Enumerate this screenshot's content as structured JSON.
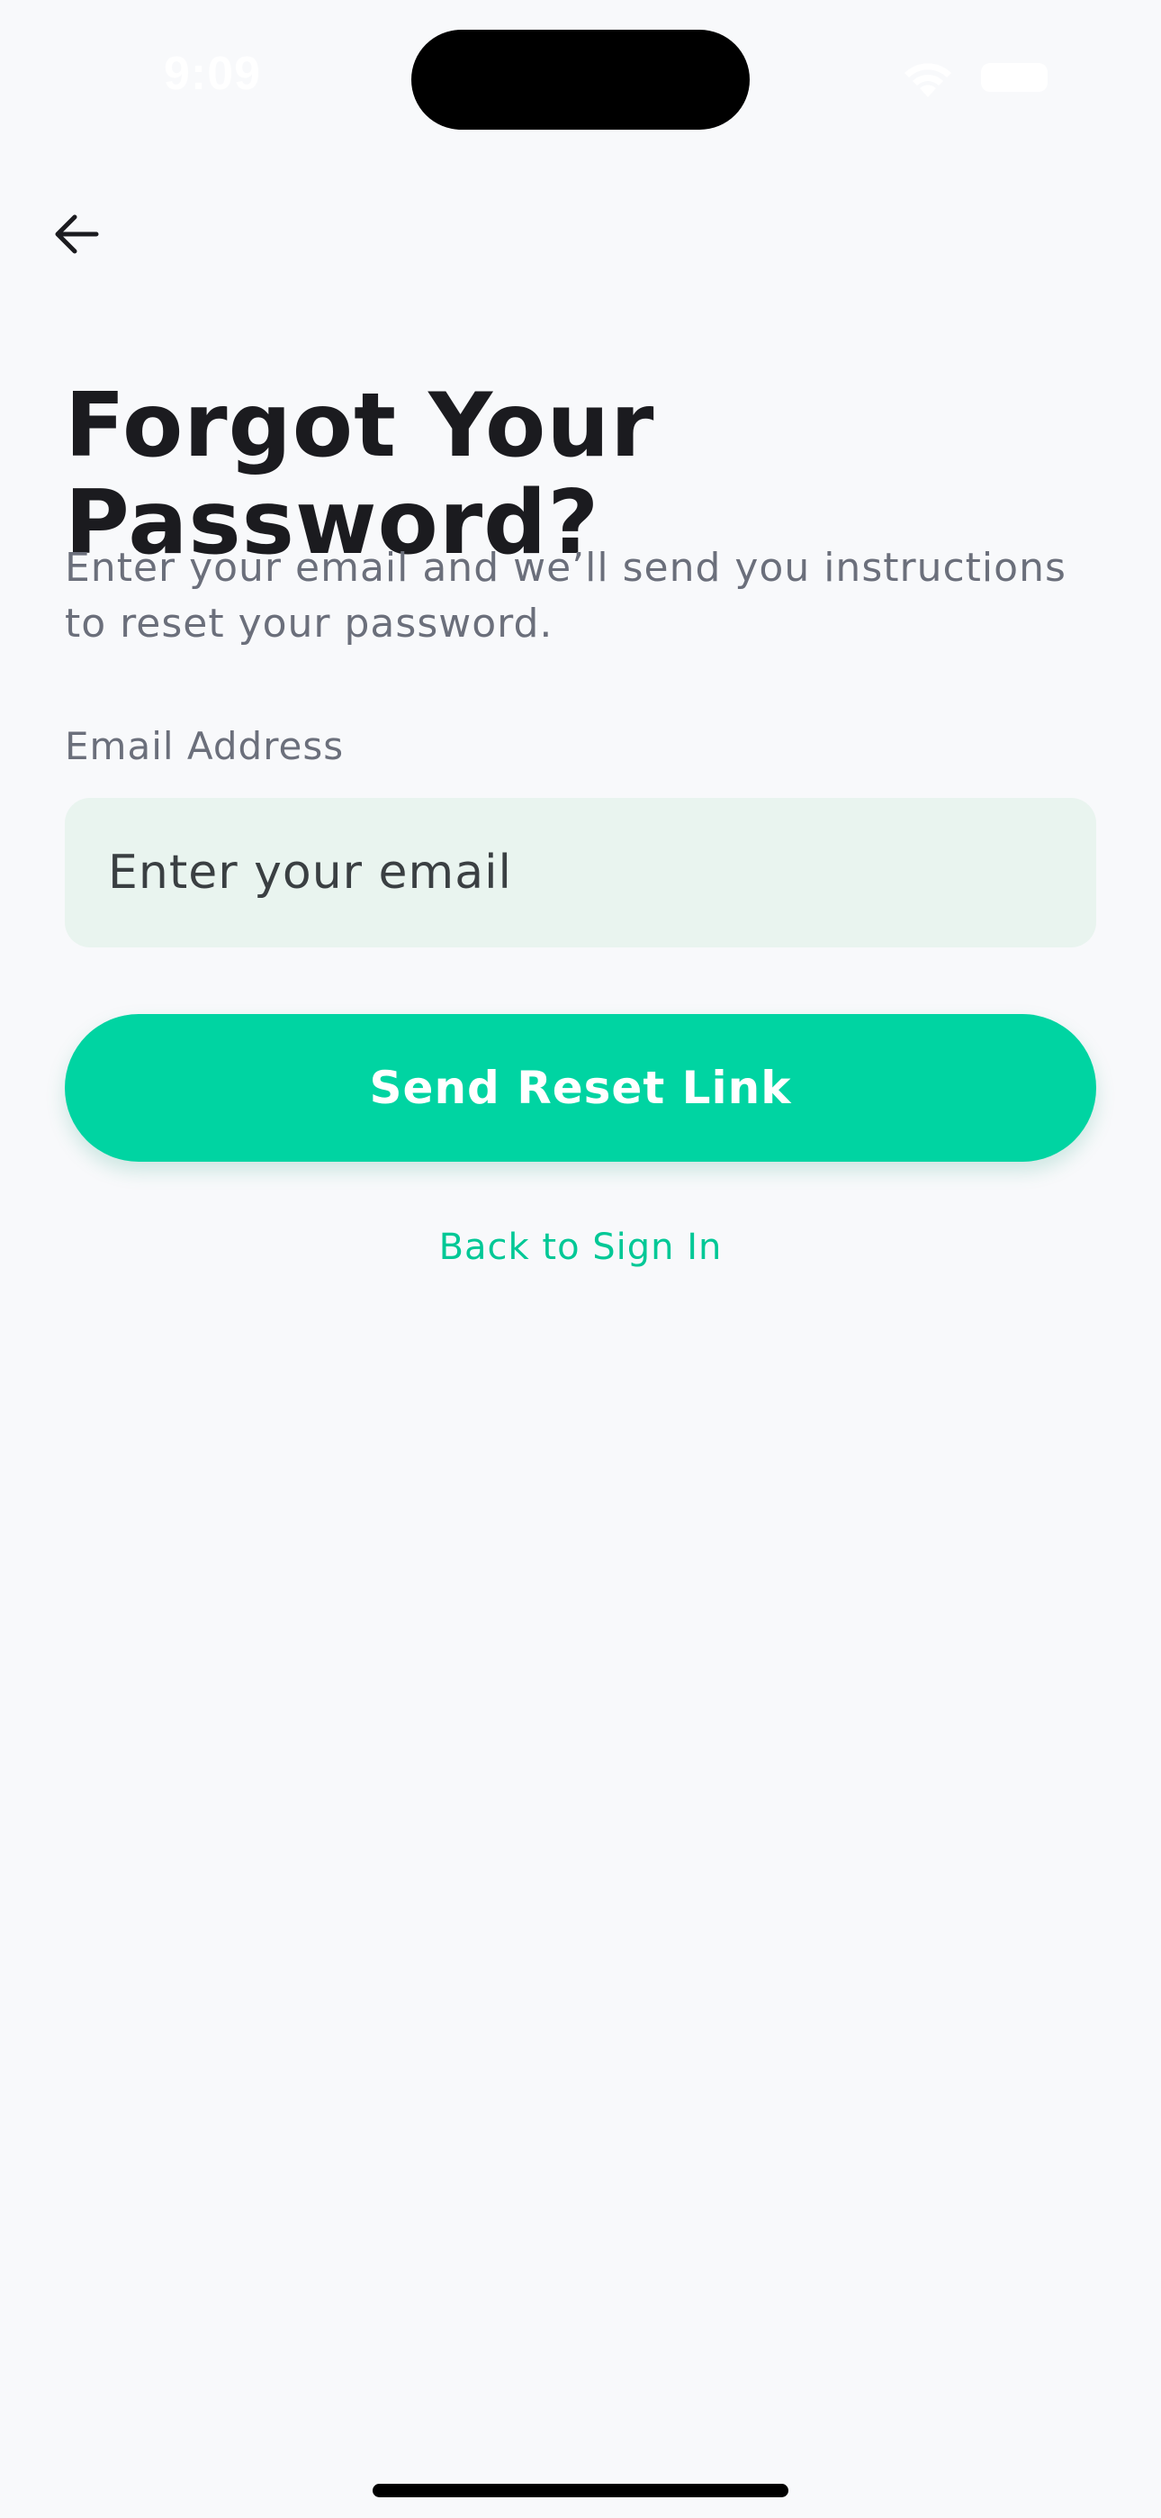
{
  "status_bar": {
    "time": "9:09",
    "icons": [
      "wifi-icon",
      "battery-icon"
    ]
  },
  "header": {
    "back_icon": "arrow-left-icon"
  },
  "main": {
    "title": "Forgot Your Password?",
    "subtitle": "Enter your email and we’ll send you instructions to reset your password.",
    "email_label": "Email Address",
    "email_placeholder": "Enter your email",
    "email_value": "",
    "submit_label": "Send Reset Link",
    "back_link_label": "Back to Sign In"
  },
  "colors": {
    "accent": "#00d4a2",
    "link": "#00c896",
    "input_bg": "#e9f4ef",
    "background": "#f8f9fb",
    "title_text": "#1b1b1f",
    "muted_text": "#6b6f7b"
  }
}
